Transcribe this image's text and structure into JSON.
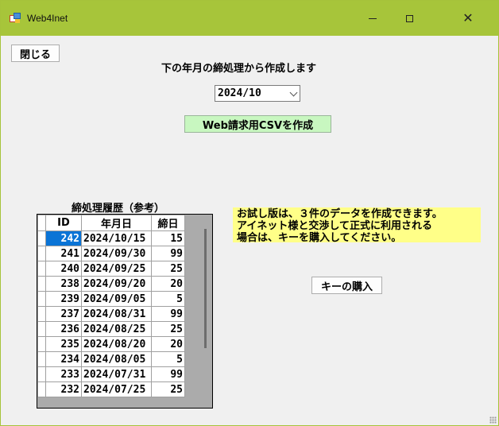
{
  "window": {
    "title": "Web4Inet",
    "minimize_glyph": "",
    "maximize_glyph": "",
    "close_glyph": "✕"
  },
  "toolbar": {
    "close_label": "閉じる"
  },
  "header": {
    "instruction": "下の年月の締処理から作成します"
  },
  "period_select": {
    "value": "2024/10"
  },
  "actions": {
    "create_csv_label": "Web請求用CSVを作成",
    "buy_key_label": "キーの購入"
  },
  "history": {
    "title": "締処理履歴（参考）",
    "columns": [
      "ID",
      "年月日",
      "締日"
    ],
    "rows": [
      {
        "id": "242",
        "date": "2024/10/15",
        "day": "15"
      },
      {
        "id": "241",
        "date": "2024/09/30",
        "day": "99"
      },
      {
        "id": "240",
        "date": "2024/09/25",
        "day": "25"
      },
      {
        "id": "238",
        "date": "2024/09/20",
        "day": "20"
      },
      {
        "id": "239",
        "date": "2024/09/05",
        "day": "5"
      },
      {
        "id": "237",
        "date": "2024/08/31",
        "day": "99"
      },
      {
        "id": "236",
        "date": "2024/08/25",
        "day": "25"
      },
      {
        "id": "235",
        "date": "2024/08/20",
        "day": "20"
      },
      {
        "id": "234",
        "date": "2024/08/05",
        "day": "5"
      },
      {
        "id": "233",
        "date": "2024/07/31",
        "day": "99"
      },
      {
        "id": "232",
        "date": "2024/07/25",
        "day": "25"
      }
    ]
  },
  "notice": {
    "lines": [
      "お試し版は、３件のデータを作成できます。",
      "アイネット様と交渉して正式に利用される",
      "場合は、キーを購入してください。"
    ]
  },
  "colors": {
    "titlebar": "#a7c53a",
    "create_button_bg": "#c8f7c0",
    "notice_bg": "#ffff88",
    "selection": "#0a74d6"
  }
}
